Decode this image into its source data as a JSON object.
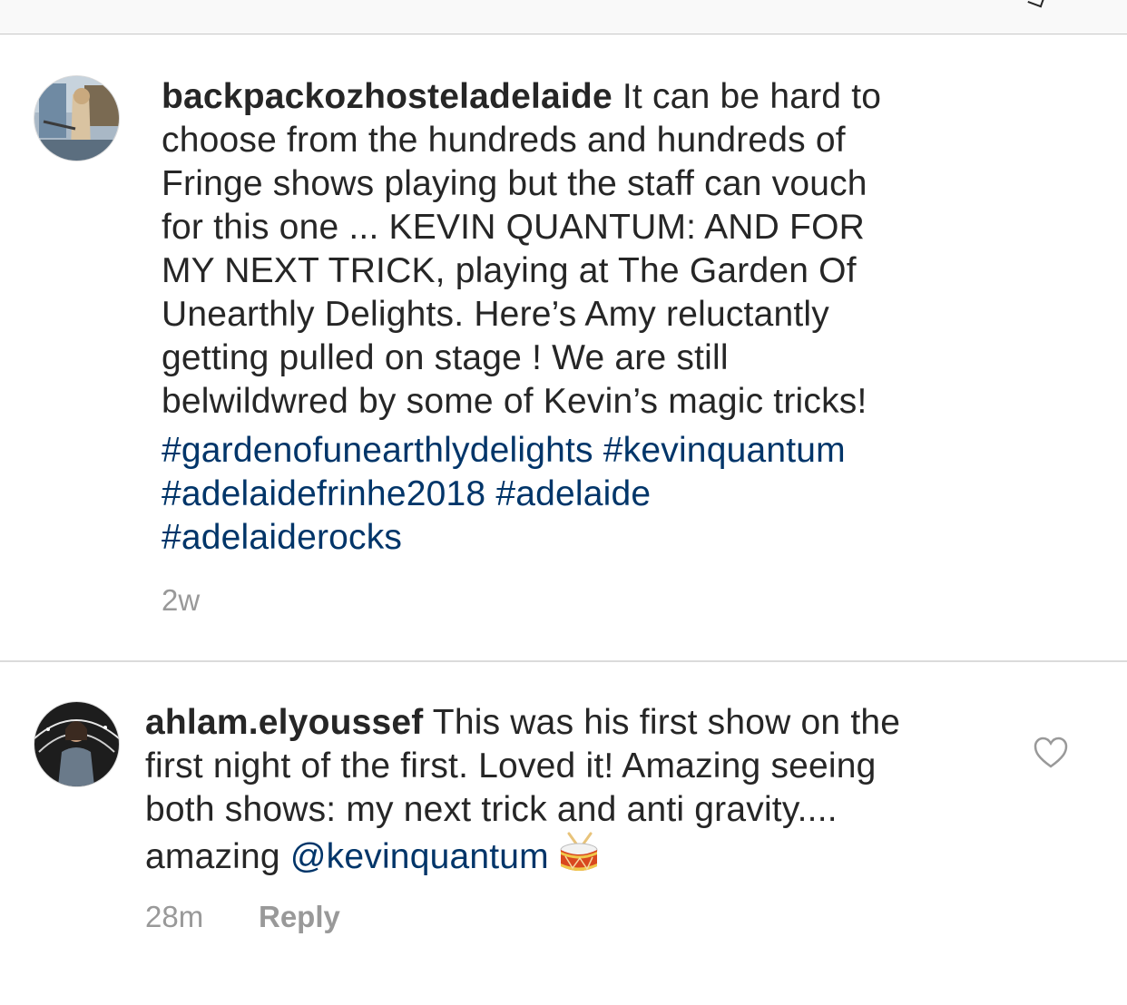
{
  "post_caption": {
    "username": "backpackozhosteladelaide",
    "text": " It can be hard to\nchoose from the hundreds and hundreds of\nFringe shows playing but the staff can vouch\nfor this one ... KEVIN QUANTUM: AND FOR\nMY NEXT TRICK, playing at The Garden Of\nUnearthly Delights. Here’s Amy reluctantly\ngetting pulled on stage ! We are still\nbelwildwred by some of Kevin’s magic tricks!",
    "hashtags": [
      "#gardenofunearthlydelights",
      "#kevinquantum",
      "#adelaidefrinhe2018",
      "#adelaide",
      "#adelaiderocks"
    ],
    "timestamp": "2w"
  },
  "comment": {
    "username": "ahlam.elyoussef",
    "text": " This was his first show on the\nfirst night of the first. Loved it! Amazing seeing\nboth shows: my next trick and anti gravity....\namazing ",
    "mention": "@kevinquantum",
    "emoji": "drum-emoji",
    "timestamp": "28m",
    "reply_label": "Reply"
  },
  "icons": {
    "heart": "heart-outline-icon"
  },
  "colors": {
    "text": "#262626",
    "link": "#003569",
    "meta": "#999999",
    "divider": "#dbdbdb"
  }
}
